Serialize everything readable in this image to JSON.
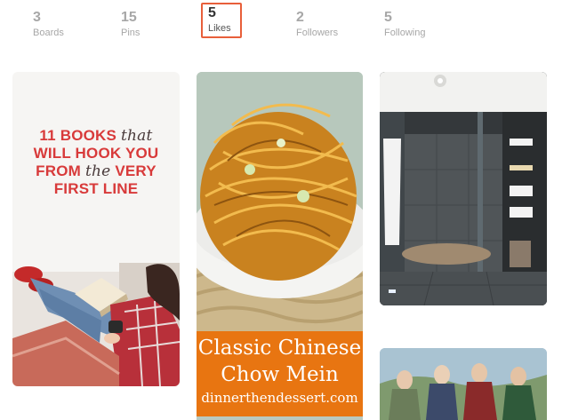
{
  "stats": [
    {
      "count": "3",
      "label": "Boards"
    },
    {
      "count": "15",
      "label": "Pins"
    },
    {
      "count": "5",
      "label": "Likes"
    },
    {
      "count": "2",
      "label": "Followers"
    },
    {
      "count": "5",
      "label": "Following"
    }
  ],
  "active_tab": "Likes",
  "accent_color": "#e85f3a",
  "pins": {
    "books": {
      "line1_a": "11 BOOKS",
      "line1_b": "that",
      "line2": "WILL HOOK YOU",
      "line3_a": "FROM",
      "line3_b": "the",
      "line3_c": "VERY",
      "line4": "FIRST LINE",
      "title_color": "#d83a3a"
    },
    "noodles": {
      "line1": "Classic Chinese",
      "line2": "Chow Mein",
      "site": "dinnerthendessert.com",
      "banner_color": "#e87511"
    },
    "bathroom": {},
    "movie": {}
  }
}
